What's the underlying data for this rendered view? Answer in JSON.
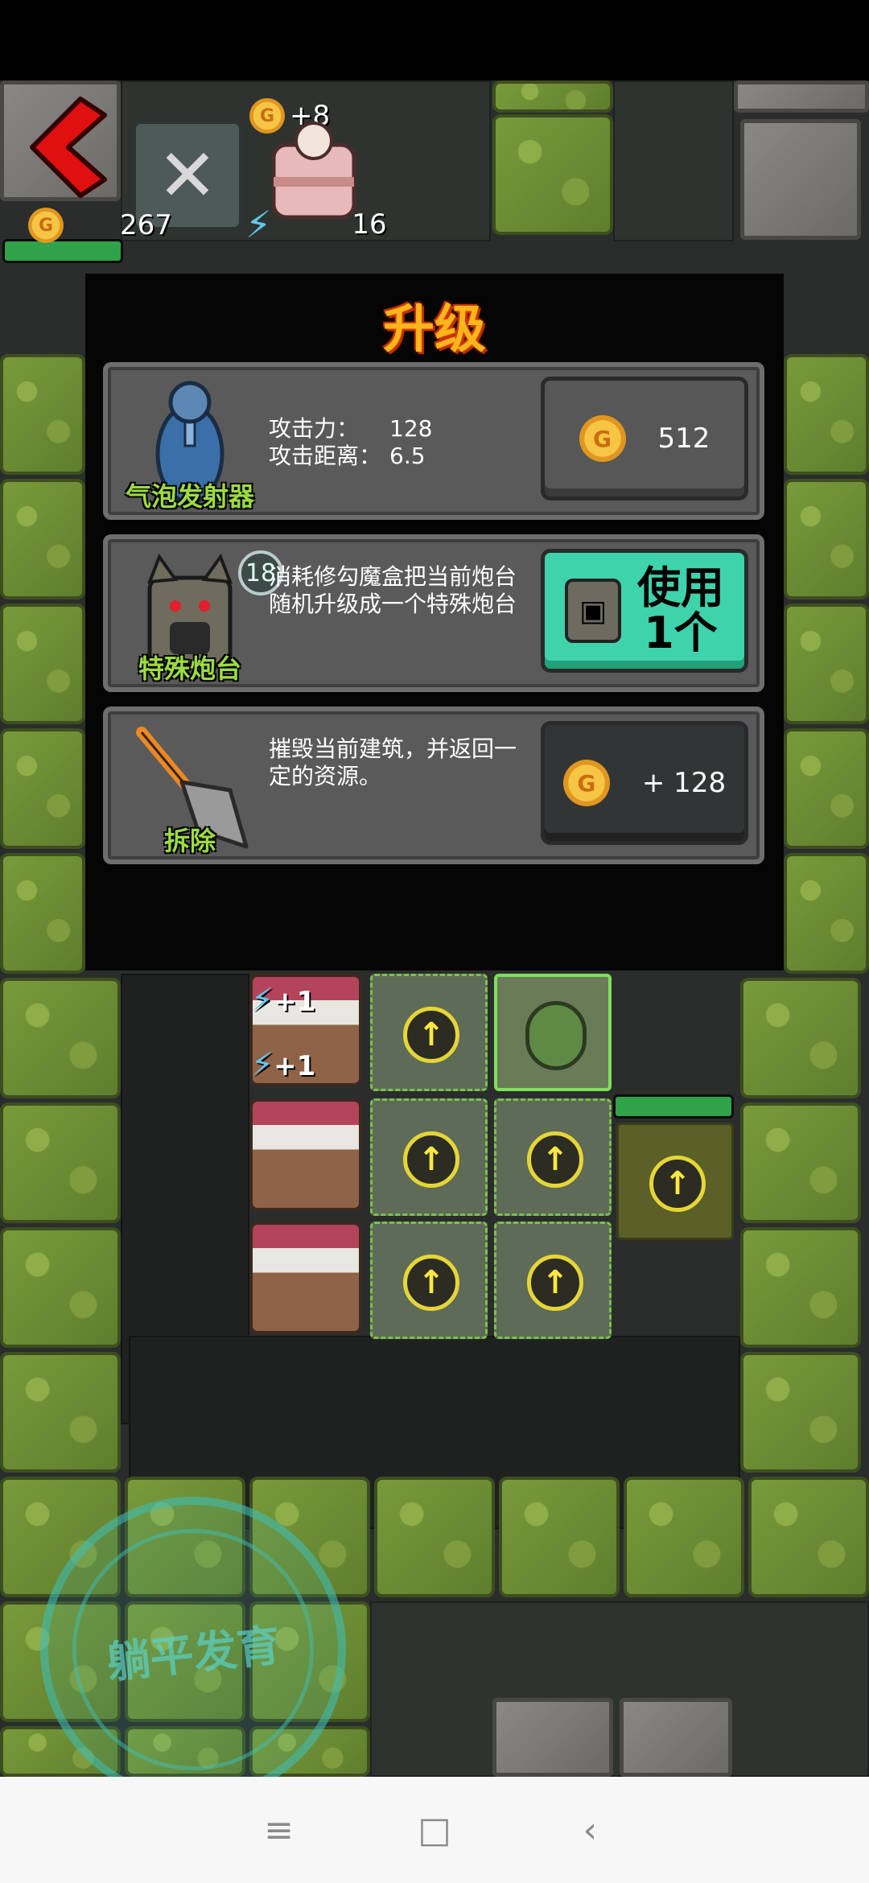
{
  "hud": {
    "gold": "267",
    "energy": "16",
    "bed_income": "+8",
    "health_fraction": 1.0,
    "coin_letter": "G"
  },
  "modal": {
    "title": "升级",
    "turret": {
      "name": "气泡发射器",
      "attack_label": "攻击力：",
      "attack_value": "128",
      "range_label": "攻击距离：",
      "range_value": "6.5",
      "upgrade_cost": "512"
    },
    "special": {
      "name": "特殊炮台",
      "count": "18",
      "description": "消耗修勾魔盒把当前炮台随机升级成一个特殊炮台",
      "use_label_line1": "使用",
      "use_label_line2": "1个"
    },
    "demolish": {
      "name": "拆除",
      "description": "摧毁当前建筑，并返回一定的资源。",
      "refund": "+ 128"
    }
  },
  "board": {
    "energy_gain_1": "+1",
    "energy_gain_2": "+1"
  },
  "watermark": "躺平发育",
  "colors": {
    "accent_teal": "#3fd3ab",
    "title_orange": "#ffb51b",
    "caption_green": "#9cdc3f",
    "back_red": "#e01010"
  },
  "icons": [
    "back-arrow-icon",
    "tools-icon",
    "bed-icon",
    "coin-icon",
    "bolt-icon",
    "upgrade-arrow-icon",
    "shovel-icon",
    "bubble-launcher-icon",
    "dog-box-icon"
  ]
}
